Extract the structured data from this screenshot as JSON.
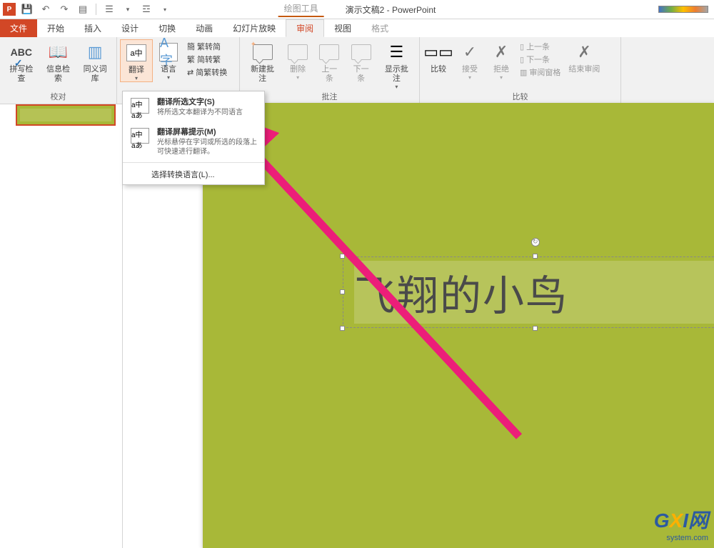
{
  "titlebar": {
    "drawing_tools": "绘图工具",
    "doc_title": "演示文稿2 - PowerPoint"
  },
  "tabs": {
    "file": "文件",
    "home": "开始",
    "insert": "插入",
    "design": "设计",
    "transitions": "切换",
    "animations": "动画",
    "slideshow": "幻灯片放映",
    "review": "审阅",
    "view": "视图",
    "format": "格式"
  },
  "ribbon": {
    "proofing": {
      "label": "校对",
      "spellcheck": "拼写检查",
      "research": "信息检索",
      "thesaurus": "同义词库"
    },
    "language": {
      "translate": "翻译",
      "lang": "语言",
      "t2s": "繁转简",
      "s2t": "简转繁",
      "convert": "简繁转换"
    },
    "comments": {
      "label": "批注",
      "new": "新建批注",
      "delete": "删除",
      "prev": "上一条",
      "next": "下一条",
      "show": "显示批注"
    },
    "compare": {
      "label": "比较",
      "compare": "比较",
      "accept": "接受",
      "reject": "拒绝",
      "prev": "上一条",
      "next": "下一条",
      "pane": "审阅窗格",
      "end": "结束审阅"
    }
  },
  "dropdown": {
    "item1_title": "翻译所选文字(S)",
    "item1_desc": "将所选文本翻译为不同语言",
    "item2_title": "翻译屏幕提示(M)",
    "item2_desc": "光标悬停在字词或所选的段落上可快速进行翻译。",
    "item3": "选择转换语言(L)..."
  },
  "slide": {
    "text": "飞翔的小鸟"
  },
  "watermark": {
    "brand_g": "G",
    "brand_x": "X",
    "brand_i": "I网",
    "sub": "system.com"
  }
}
